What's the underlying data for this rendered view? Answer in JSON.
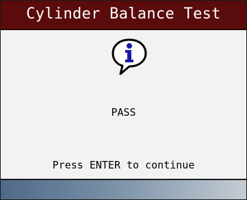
{
  "header": {
    "title": "Cylinder Balance Test"
  },
  "dialog": {
    "icon": "info-icon",
    "status": "PASS",
    "prompt": "Press ENTER to continue"
  },
  "colors": {
    "title_bar": "#5a0c0c",
    "background": "#f2f2f2",
    "icon_blue": "#1a1aa8",
    "bottom_bar_start": "#4f6a88",
    "bottom_bar_end": "#c4ccd4"
  }
}
